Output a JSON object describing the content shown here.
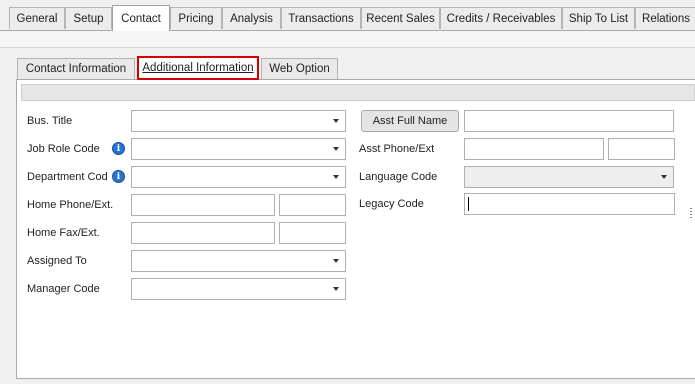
{
  "top_tabs": [
    {
      "label": "General"
    },
    {
      "label": "Setup"
    },
    {
      "label": "Contact"
    },
    {
      "label": "Pricing"
    },
    {
      "label": "Analysis"
    },
    {
      "label": "Transactions"
    },
    {
      "label": "Recent Sales"
    },
    {
      "label": "Credits / Receivables"
    },
    {
      "label": "Ship To List"
    },
    {
      "label": "Relations"
    }
  ],
  "active_top_tab": "Contact",
  "sub_tabs": [
    {
      "label": "Contact Information"
    },
    {
      "label": "Additional Information"
    },
    {
      "label": "Web Option"
    }
  ],
  "active_sub_tab": "Additional Information",
  "form": {
    "bus_title_label": "Bus. Title",
    "job_role_label": "Job Role Code",
    "department_label": "Department Code",
    "home_phone_label": "Home Phone/Ext.",
    "home_fax_label": "Home Fax/Ext.",
    "assigned_to_label": "Assigned To",
    "manager_code_label": "Manager Code",
    "asst_full_name_button": "Asst Full Name",
    "asst_phone_label": "Asst Phone/Ext",
    "language_code_label": "Language Code",
    "legacy_code_label": "Legacy Code"
  },
  "icons": {
    "info": "i"
  },
  "colors": {
    "active_highlight": "#d40000",
    "info_icon": "#2a73d1"
  }
}
